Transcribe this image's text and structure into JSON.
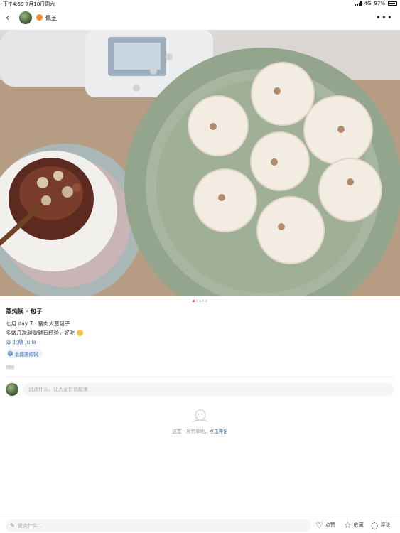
{
  "status_bar": {
    "time_date": "下午4:59  7月18日周六",
    "network": "4G",
    "battery": "97%"
  },
  "nav": {
    "back_icon": "chevron-left-icon",
    "user_name": "佩芝",
    "more_icon": "more-horizontal-icon"
  },
  "carousel": {
    "pages": 5,
    "active_index": 0
  },
  "post": {
    "title": "蒸炖锅 · 包子",
    "desc_line1": "七月 day 7 · 猪肉大葱包子",
    "desc_line2": "多做几次越做越有经验，好吃",
    "mention": "@ 北鼎 Julia",
    "topic": "北鼎蒸炖锅",
    "date": "刚刚"
  },
  "comments": {
    "input_placeholder": "说点什么，让大家讨论起来",
    "empty_text": "这是一片荒草地，",
    "empty_link": "点击评论"
  },
  "bottom_bar": {
    "input_placeholder": "说点什么...",
    "like_label": "点赞",
    "collect_label": "收藏",
    "comment_label": "评论"
  }
}
